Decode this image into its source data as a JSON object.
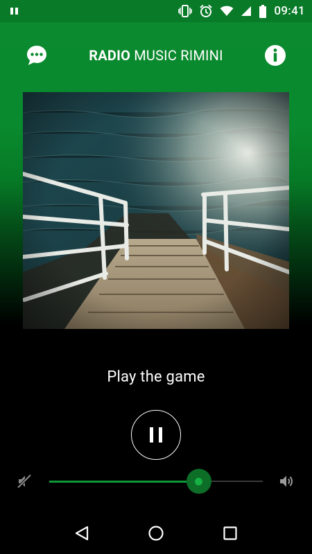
{
  "status_bar": {
    "time": "09:41",
    "icons": [
      "notification-icon",
      "vibrate-icon",
      "alarm-icon",
      "wifi-icon",
      "signal-icon",
      "battery-icon"
    ]
  },
  "header": {
    "title_bold": "RADIO",
    "title_rest": " MUSIC RIMINI",
    "left_icon": "chat-icon",
    "right_icon": "info-icon"
  },
  "player": {
    "track_title": "Play the game",
    "state": "playing",
    "volume_level": 0.7
  },
  "colors": {
    "brand_green": "#0b8a2f",
    "accent_green": "#16b043",
    "background": "#000000"
  },
  "nav": {
    "icons": [
      "back-icon",
      "home-icon",
      "recents-icon"
    ]
  }
}
